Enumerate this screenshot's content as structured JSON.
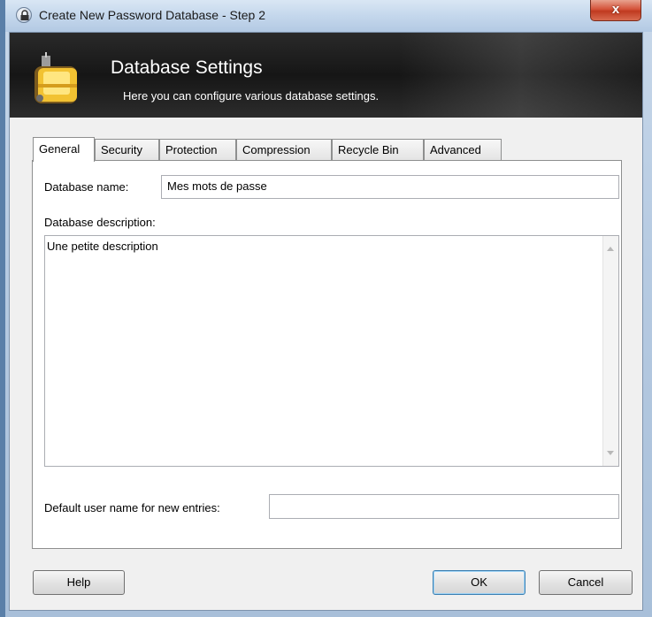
{
  "window": {
    "title": "Create New Password Database - Step 2",
    "close_label": "x"
  },
  "banner": {
    "title": "Database Settings",
    "subtitle": "Here you can configure various database settings."
  },
  "tabs": [
    {
      "label": "General",
      "active": true
    },
    {
      "label": "Security",
      "active": false
    },
    {
      "label": "Protection",
      "active": false
    },
    {
      "label": "Compression",
      "active": false
    },
    {
      "label": "Recycle Bin",
      "active": false
    },
    {
      "label": "Advanced",
      "active": false
    }
  ],
  "general": {
    "name_label": "Database name:",
    "name_value": "Mes mots de passe",
    "description_label": "Database description:",
    "description_value": "Une petite description",
    "default_user_label": "Default user name for new entries:",
    "default_user_value": ""
  },
  "buttons": {
    "help": "Help",
    "ok": "OK",
    "cancel": "Cancel"
  },
  "colors": {
    "banner_bg": "#1e1e1e",
    "close_button": "#c8452b",
    "default_button_border": "#3c7fb1"
  },
  "icons": {
    "title_icon": "lock-icon",
    "banner_icon": "database-settings-icon"
  }
}
